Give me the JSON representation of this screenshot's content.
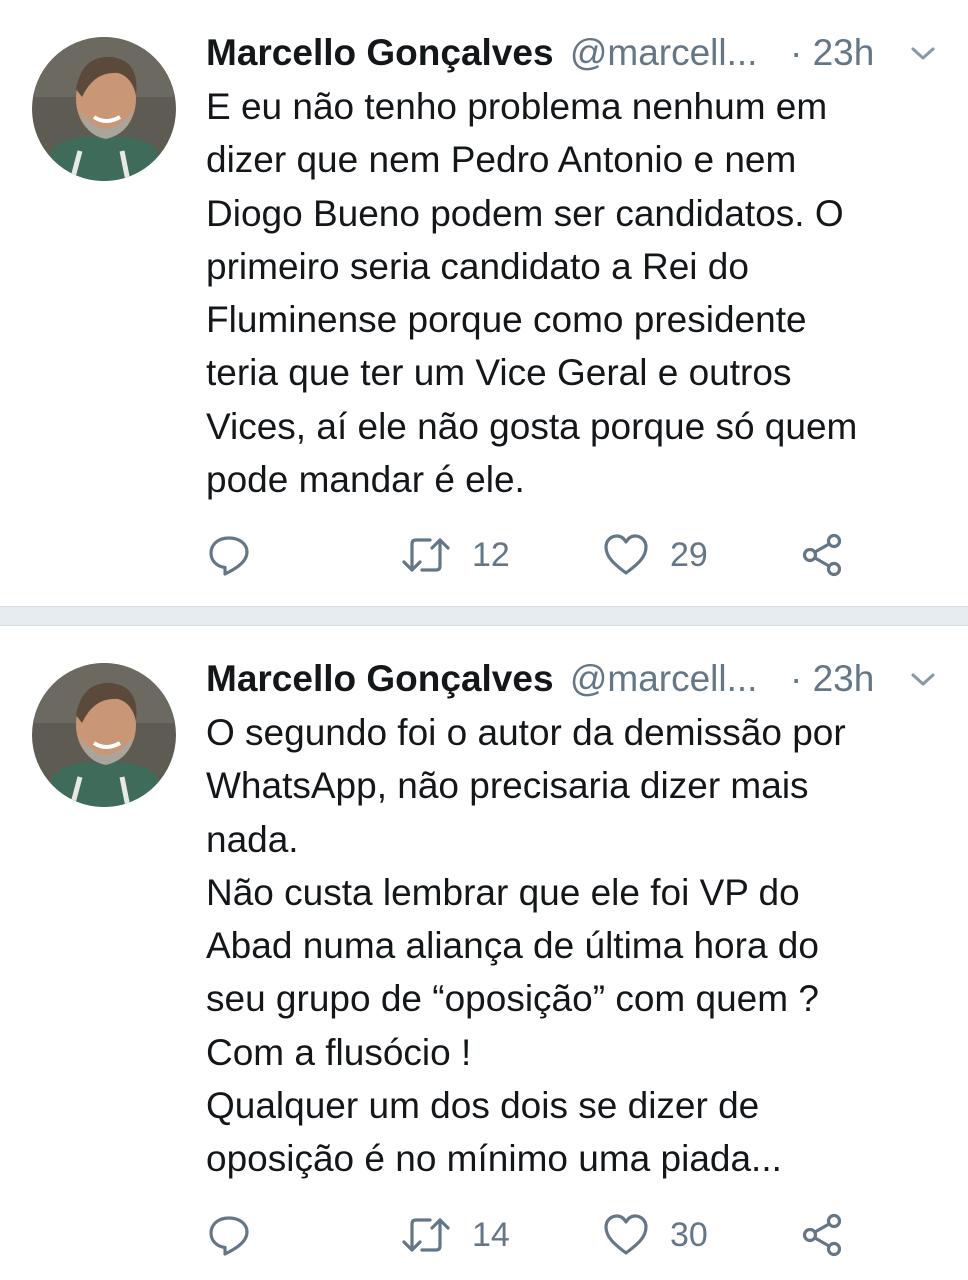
{
  "tweets": [
    {
      "author_name": "Marcello Gonçalves",
      "author_handle": "@marcell...",
      "time": "· 23h",
      "text": "E eu não tenho problema nenhum em\ndizer que nem Pedro Antonio e nem\nDiogo Bueno podem ser candidatos. O\nprimeiro seria candidato a Rei do\nFluminense porque como presidente\nteria que ter um Vice Geral e outros\nVices, aí ele não gosta porque só quem\npode mandar é ele.",
      "retweets": "12",
      "likes": "29"
    },
    {
      "author_name": "Marcello Gonçalves",
      "author_handle": "@marcell...",
      "time": "· 23h",
      "text": "O segundo foi o autor da demissão por\nWhatsApp, não precisaria dizer mais\nnada.\nNão custa lembrar que ele foi VP do\nAbad numa aliança de última hora do\nseu grupo de “oposição” com quem ?\nCom a flusócio !\nQualquer um dos dois se dizer de\noposição é no mínimo uma piada...",
      "retweets": "14",
      "likes": "30"
    }
  ],
  "icons": {
    "reply": "reply-icon",
    "retweet": "retweet-icon",
    "like": "heart-icon",
    "share": "share-icon",
    "more": "chevron-down-icon"
  },
  "colors": {
    "text": "#14171a",
    "muted": "#657786",
    "divider": "#e6ecf0"
  }
}
